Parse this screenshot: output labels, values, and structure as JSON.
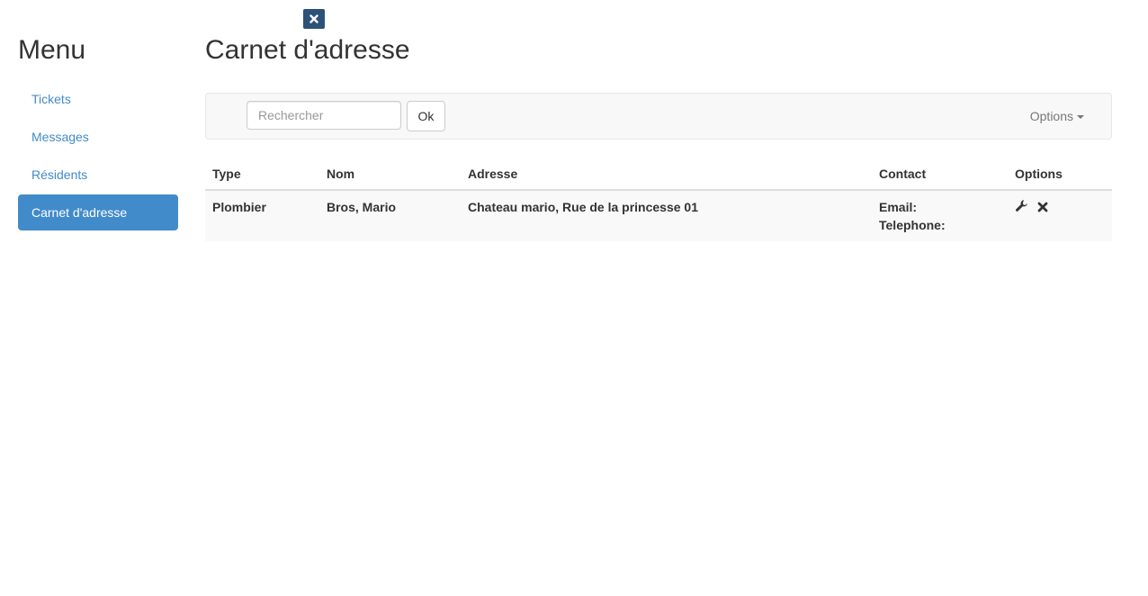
{
  "close_icon": "close-icon",
  "sidebar": {
    "title": "Menu",
    "items": [
      {
        "label": "Tickets",
        "active": false
      },
      {
        "label": "Messages",
        "active": false
      },
      {
        "label": "Résidents",
        "active": false
      },
      {
        "label": "Carnet d'adresse",
        "active": true
      }
    ],
    "accent_color": "#428bca"
  },
  "main": {
    "title": "Carnet d'adresse"
  },
  "toolbar": {
    "search_placeholder": "Rechercher",
    "search_value": "",
    "ok_label": "Ok",
    "options_label": "Options"
  },
  "table": {
    "headers": [
      "Type",
      "Nom",
      "Adresse",
      "Contact",
      "Options"
    ],
    "rows": [
      {
        "type": "Plombier",
        "nom": "Bros, Mario",
        "adresse": "Chateau mario, Rue de la princesse 01",
        "email_label": "Email:",
        "telephone_label": "Telephone:",
        "icons": [
          "wrench-icon",
          "delete-icon"
        ]
      }
    ]
  }
}
